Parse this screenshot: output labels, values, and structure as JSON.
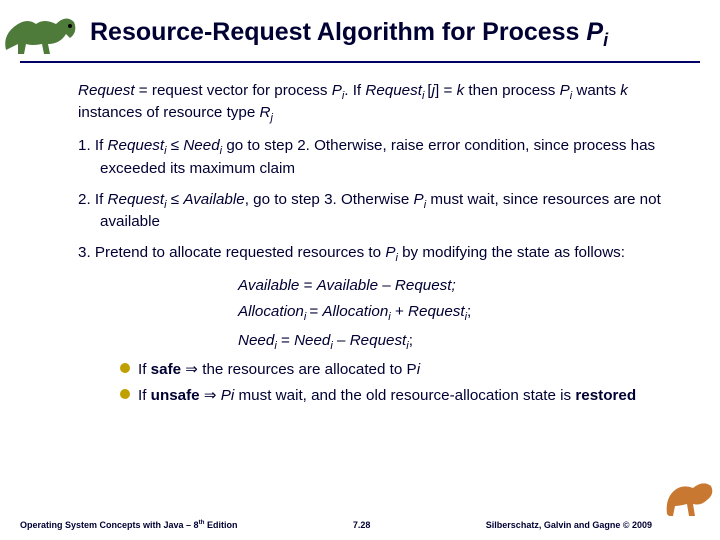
{
  "header": {
    "title_prefix": "Resource-Request Algorithm for Process ",
    "title_proc": "P",
    "title_sub": "i"
  },
  "body": {
    "intro_a": "Request",
    "intro_b": " = request vector for process ",
    "intro_c": "P",
    "intro_c_sub": "i",
    "intro_d": ".  If ",
    "intro_e": "Request",
    "intro_e_sub": "i ",
    "intro_f": "[",
    "intro_g": "j",
    "intro_h": "] = ",
    "intro_i": "k",
    "intro_j": " then process ",
    "intro_k": "P",
    "intro_k_sub": "i",
    "intro_l": " wants ",
    "intro_m": "k",
    "intro_n": " instances of resource type ",
    "intro_o": "R",
    "intro_o_sub": "j",
    "s1_a": "1. If ",
    "s1_b": "Request",
    "s1_b_sub": "i",
    "s1_c": " ≤ ",
    "s1_d": "Need",
    "s1_d_sub": "i",
    "s1_e": " go to step 2.  Otherwise, raise error condition, since process has exceeded its maximum claim",
    "s2_a": "2. If ",
    "s2_b": "Request",
    "s2_b_sub": "i",
    "s2_c": " ≤ ",
    "s2_d": "Available",
    "s2_e": ", go to step 3.  Otherwise ",
    "s2_f": "P",
    "s2_f_sub": "i",
    "s2_g": "  must wait, since resources are not available",
    "s3_a": "3. Pretend to allocate requested resources to ",
    "s3_b": "P",
    "s3_b_sub": "i",
    "s3_c": " by modifying the state as follows:",
    "eq1_a": "Available",
    "eq1_b": " = ",
    "eq1_c": "Available",
    "eq1_d": "  – ",
    "eq1_e": "Request;",
    "eq2_a": "Allocation",
    "eq2_a_sub": "i ",
    "eq2_b": "= ",
    "eq2_c": "Allocation",
    "eq2_c_sub": "i",
    "eq2_d": " + ",
    "eq2_e": "Request",
    "eq2_e_sub": "i",
    "eq2_f": ";",
    "eq3_a": "Need",
    "eq3_a_sub": "i",
    "eq3_b": " = ",
    "eq3_c": "Need",
    "eq3_c_sub": "i",
    "eq3_d": " – ",
    "eq3_e": "Request",
    "eq3_e_sub": "i",
    "eq3_f": ";",
    "b1_a": "If ",
    "b1_b": "safe",
    "b1_c": " ⇒ the resources are allocated to P",
    "b1_d": "i",
    "b2_a": "If ",
    "b2_b": "unsafe",
    "b2_c": " ⇒ ",
    "b2_d": "Pi",
    "b2_e": " must wait, and the old resource-allocation state is ",
    "b2_f": "restored"
  },
  "footer": {
    "left_a": "Operating System Concepts  with Java – 8",
    "left_sup": "th",
    "left_b": " Edition",
    "center": "7.28",
    "right": "Silberschatz, Galvin and Gagne © 2009"
  }
}
